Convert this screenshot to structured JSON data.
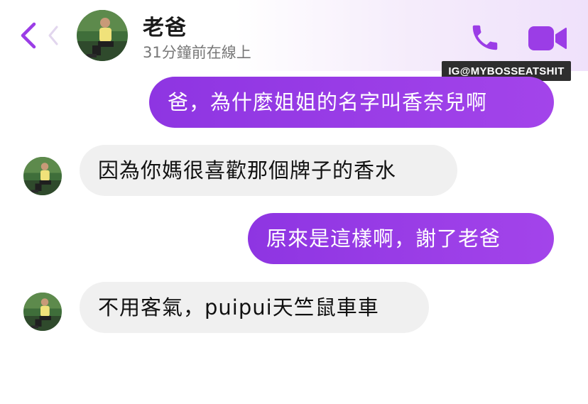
{
  "header": {
    "contact_name": "老爸",
    "status": "31分鐘前在線上"
  },
  "watermark": "IG@MYBOSSEATSHIT",
  "messages": [
    {
      "direction": "outgoing",
      "text": "爸，為什麼姐姐的名字叫香奈兒啊"
    },
    {
      "direction": "incoming",
      "text": "因為你媽很喜歡那個牌子的香水"
    },
    {
      "direction": "outgoing",
      "text": "原來是這樣啊，謝了老爸"
    },
    {
      "direction": "incoming",
      "text": "不用客氣，puipui天竺鼠車車"
    }
  ],
  "icons": {
    "back": "chevron-left-icon",
    "call": "phone-icon",
    "video": "video-camera-icon"
  },
  "colors": {
    "accent": "#9b3de6",
    "incoming_bubble": "#f0f0f0",
    "status_text": "#777777"
  }
}
